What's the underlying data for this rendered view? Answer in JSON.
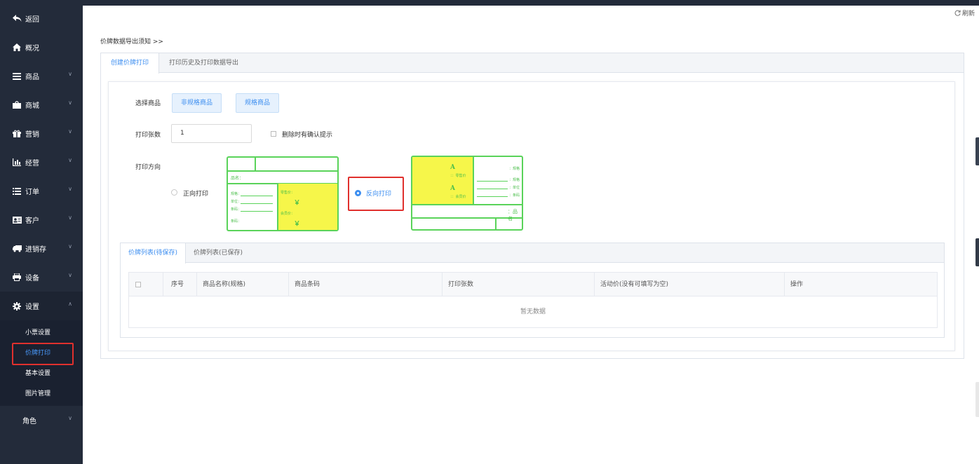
{
  "sidebar": {
    "items": [
      {
        "label": "返回",
        "icon": "back-arrow-icon"
      },
      {
        "label": "概况",
        "icon": "home-icon"
      },
      {
        "label": "商品",
        "icon": "menu-lines-icon"
      },
      {
        "label": "商城",
        "icon": "shopping-bag-icon"
      },
      {
        "label": "营销",
        "icon": "gift-icon"
      },
      {
        "label": "经营",
        "icon": "bar-chart-icon"
      },
      {
        "label": "订单",
        "icon": "list-icon"
      },
      {
        "label": "客户",
        "icon": "id-card-icon"
      },
      {
        "label": "进销存",
        "icon": "truck-icon"
      },
      {
        "label": "设备",
        "icon": "printer-icon"
      },
      {
        "label": "设置",
        "icon": "gear-icon"
      }
    ],
    "sub_items": [
      "小票设置",
      "价牌打印",
      "基本设置",
      "图片管理"
    ],
    "role_label": "角色"
  },
  "topbar": {
    "refresh_label": "刷新"
  },
  "main": {
    "notice_link": "价牌数据导出须知 >>",
    "tabs": [
      "创建价牌打印",
      "打印历史及打印数据导出"
    ],
    "form": {
      "select_goods_label": "选择商品",
      "non_spec_button": "非规格商品",
      "spec_button": "规格商品",
      "print_count_label": "打印张数",
      "print_count_value": "1",
      "delete_confirm_label": "删除时有确认提示",
      "direction_label": "打印方向",
      "forward_label": "正向打印",
      "reverse_label": "反向打印"
    },
    "label_forward": {
      "name_label": "品名：",
      "rows": [
        "规格：",
        "单位：",
        "条码：",
        "条码："
      ],
      "retail_label": "零售价：",
      "member_label": "会员价：",
      "currency": "￥"
    },
    "label_reverse": {
      "A1": "A",
      "A2": "A",
      "sub1": "：：零售价",
      "sub2": "：：会员价",
      "rows": [
        "：规格",
        "：规格",
        "：单位",
        "：条码"
      ],
      "name_label": "：品名"
    },
    "list": {
      "tabs": [
        "价牌列表(待保存)",
        "价牌列表(已保存)"
      ],
      "columns": [
        "序号",
        "商品名称(规格)",
        "商品条码",
        "打印张数",
        "活动价(没有可填写为空)",
        "操作"
      ],
      "empty_text": "暂无数据"
    }
  }
}
